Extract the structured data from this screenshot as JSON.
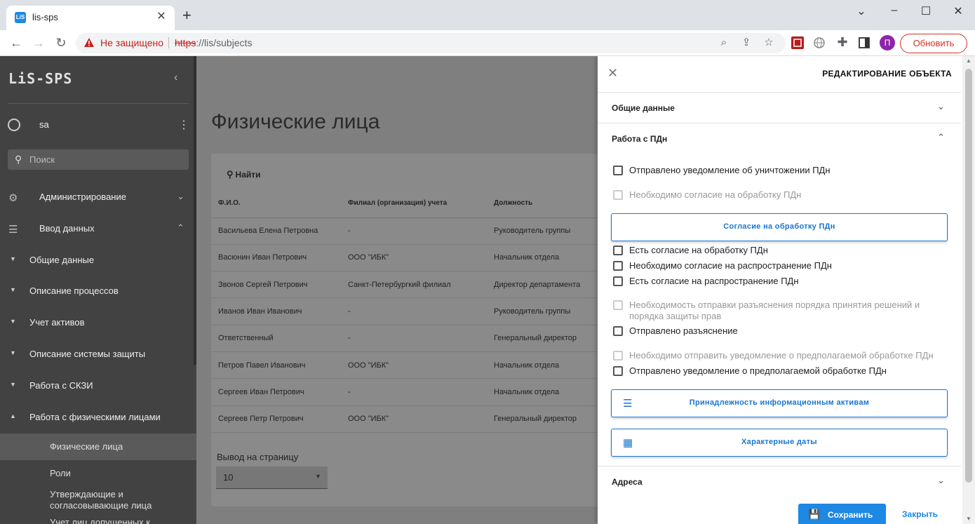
{
  "browser": {
    "tab_title": "lis-sps",
    "tab_favicon": "LiS",
    "not_secure_label": "Не защищено",
    "url_scheme": "https",
    "url_rest": "://lis/subjects",
    "update_button": "Обновить",
    "profile_initial": "П"
  },
  "sidebar": {
    "logo": "LiS-SPS",
    "user": "sa",
    "search_placeholder": "Поиск",
    "sections": [
      {
        "label": "Администрирование",
        "icon": "gear-icon"
      },
      {
        "label": "Ввод данных",
        "icon": "database-icon"
      }
    ],
    "subsections": [
      {
        "label": "Общие данные"
      },
      {
        "label": "Описание процессов"
      },
      {
        "label": "Учет активов"
      },
      {
        "label": "Описание системы защиты"
      },
      {
        "label": "Работа с СКЗИ"
      },
      {
        "label": "Работа с физическими лицами"
      }
    ],
    "leaves": [
      {
        "label": "Физические лица"
      },
      {
        "label": "Роли"
      },
      {
        "label": "Утверждающие и согласовывающие лица"
      },
      {
        "label": "Учет лиц допущенных к"
      }
    ]
  },
  "main": {
    "title": "Физические лица",
    "find_button": "Найти",
    "columns": [
      "Ф.И.О.",
      "Филиал (организация) учета",
      "Должность"
    ],
    "rows": [
      [
        "Васильева Елена Петровна",
        "-",
        "Руководитель группы"
      ],
      [
        "Васюнин Иван Петрович",
        "ООО \"ИБК\"",
        "Начальник отдела"
      ],
      [
        "Звонов Сергей Петрович",
        "Санкт-Петербургкий филиал",
        "Директор департамента"
      ],
      [
        "Иванов Иван Иванович",
        "-",
        "Руководитель группы"
      ],
      [
        "Ответственный",
        "-",
        "Генеральный директор"
      ],
      [
        "Петров Павел Иванович",
        "ООО \"ИБК\"",
        "Начальник отдела"
      ],
      [
        "Сергеев Иван Петрович",
        "-",
        "Начальник отдела"
      ],
      [
        "Сергеев Петр Петрович",
        "ООО \"ИБК\"",
        "Генеральный директор"
      ]
    ],
    "per_page_label": "Вывод на страницу",
    "per_page_value": "10"
  },
  "drawer": {
    "title": "РЕДАКТИРОВАНИЕ ОБЪЕКТА",
    "sections": {
      "general": "Общие данные",
      "pdn": "Работа с ПДн",
      "addresses": "Адреса"
    },
    "checkboxes": [
      {
        "label": "Отправлено уведомление об уничтожении ПДн",
        "disabled": false
      },
      {
        "label": "Необходимо согласие на обработку ПДн",
        "disabled": true
      },
      {
        "label": "Есть согласие на обработку ПДн",
        "disabled": false
      },
      {
        "label": "Необходимо согласие на распространение ПДн",
        "disabled": false
      },
      {
        "label": "Есть согласие на распространение ПДн",
        "disabled": false
      },
      {
        "label": "Необходимость отправки разъяснения порядка принятия решений и порядка защиты прав",
        "disabled": true
      },
      {
        "label": "Отправлено разъяснение",
        "disabled": false
      },
      {
        "label": "Необходимо отправить уведомление о предполагаемой обработке ПДн",
        "disabled": true
      },
      {
        "label": "Отправлено уведомление о предполагаемой обработке ПДн",
        "disabled": false
      }
    ],
    "consent_button": "Согласие на обработку ПДн",
    "assets_button": "Принадлежность информационным активам",
    "dates_button": "Характерные даты",
    "save_button": "Сохранить",
    "close_button": "Закрыть"
  },
  "colors": {
    "accent": "#1976d2",
    "sidebar_bg": "#424242",
    "insecure": "#c5221f"
  }
}
